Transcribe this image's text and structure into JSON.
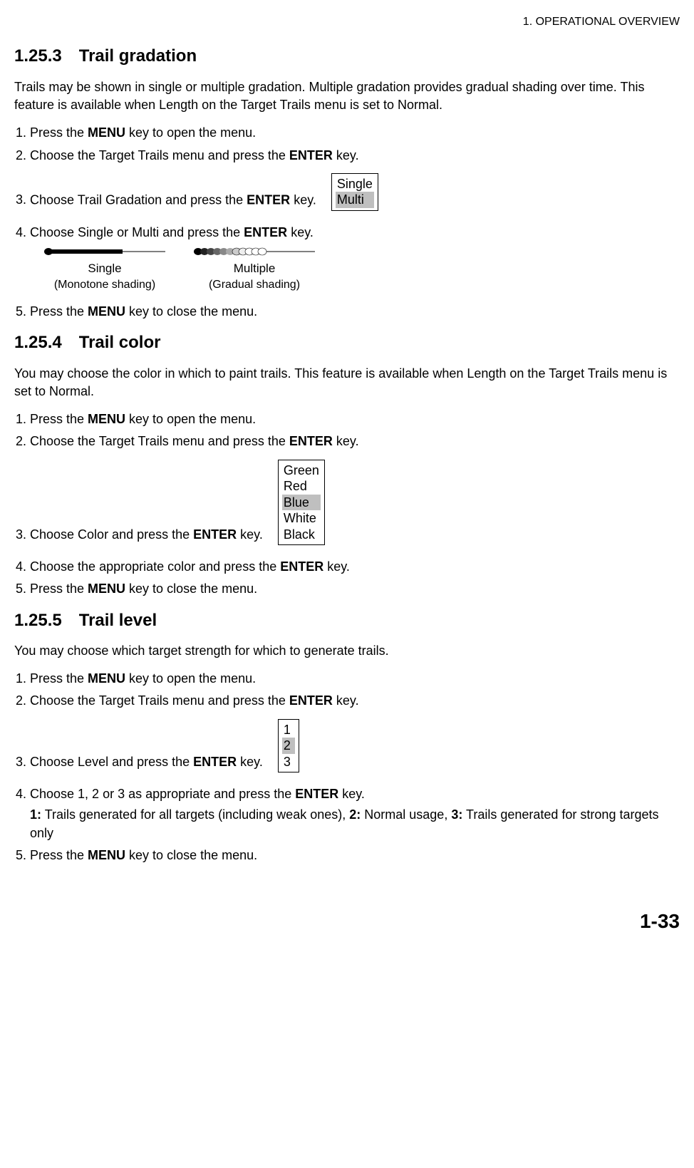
{
  "header": "1. OPERATIONAL OVERVIEW",
  "s1253": {
    "num": "1.25.3",
    "title": "Trail gradation",
    "intro": "Trails may be shown in single or multiple gradation. Multiple gradation provides gradual shading over time. This feature is available when Length on the Target Trails menu is set to Normal.",
    "step1a": "Press the ",
    "step1b": "MENU",
    "step1c": " key to open the menu.",
    "step2a": "Choose the Target Trails menu and press the ",
    "step2b": "ENTER",
    "step2c": " key.",
    "step3a": "Choose Trail Gradation and press the ",
    "step3b": "ENTER",
    "step3c": " key.",
    "box": {
      "opt1": "Single",
      "opt2": "Multi"
    },
    "step4a": "Choose Single or Multi and press the ",
    "step4b": "ENTER",
    "step4c": " key.",
    "shading": {
      "single_main": "Single",
      "single_sub": "(Monotone shading)",
      "multi_main": "Multiple",
      "multi_sub": "(Gradual shading)"
    },
    "step5a": "Press the ",
    "step5b": "MENU",
    "step5c": " key to close the menu."
  },
  "s1254": {
    "num": "1.25.4",
    "title": "Trail color",
    "intro": "You may choose the color in which to paint trails. This feature is available when Length on the Target Trails menu is set to Normal.",
    "step1a": "Press the ",
    "step1b": "MENU",
    "step1c": " key to open the menu.",
    "step2a": "Choose the Target Trails menu and press the ",
    "step2b": "ENTER",
    "step2c": " key.",
    "step3a": "Choose Color and press the ",
    "step3b": "ENTER",
    "step3c": " key.",
    "box": {
      "opt1": "Green",
      "opt2": "Red",
      "opt3": "Blue",
      "opt4": "White",
      "opt5": "Black"
    },
    "step4a": "Choose the appropriate color and press the ",
    "step4b": "ENTER",
    "step4c": " key.",
    "step5a": "Press the ",
    "step5b": "MENU",
    "step5c": " key to close the menu."
  },
  "s1255": {
    "num": "1.25.5",
    "title": "Trail level",
    "intro": "You may choose which target strength for which to generate trails.",
    "step1a": "Press the ",
    "step1b": "MENU",
    "step1c": " key to open the menu.",
    "step2a": "Choose the Target Trails menu and press the ",
    "step2b": "ENTER",
    "step2c": " key.",
    "step3a": "Choose Level and press the ",
    "step3b": "ENTER",
    "step3c": " key.",
    "box": {
      "opt1": "1",
      "opt2": "2",
      "opt3": "3"
    },
    "step4a": "Choose 1, 2 or 3 as appropriate and press the ",
    "step4b": "ENTER",
    "step4c": " key.",
    "step4sub_1b": "1:",
    "step4sub_1t": " Trails generated for all targets (including weak ones), ",
    "step4sub_2b": "2:",
    "step4sub_2t": " Normal usage, ",
    "step4sub_3b": "3:",
    "step4sub_3t": " Trails generated for strong targets only",
    "step5a": "Press the ",
    "step5b": "MENU",
    "step5c": " key to close the menu."
  },
  "footer": "1-33"
}
